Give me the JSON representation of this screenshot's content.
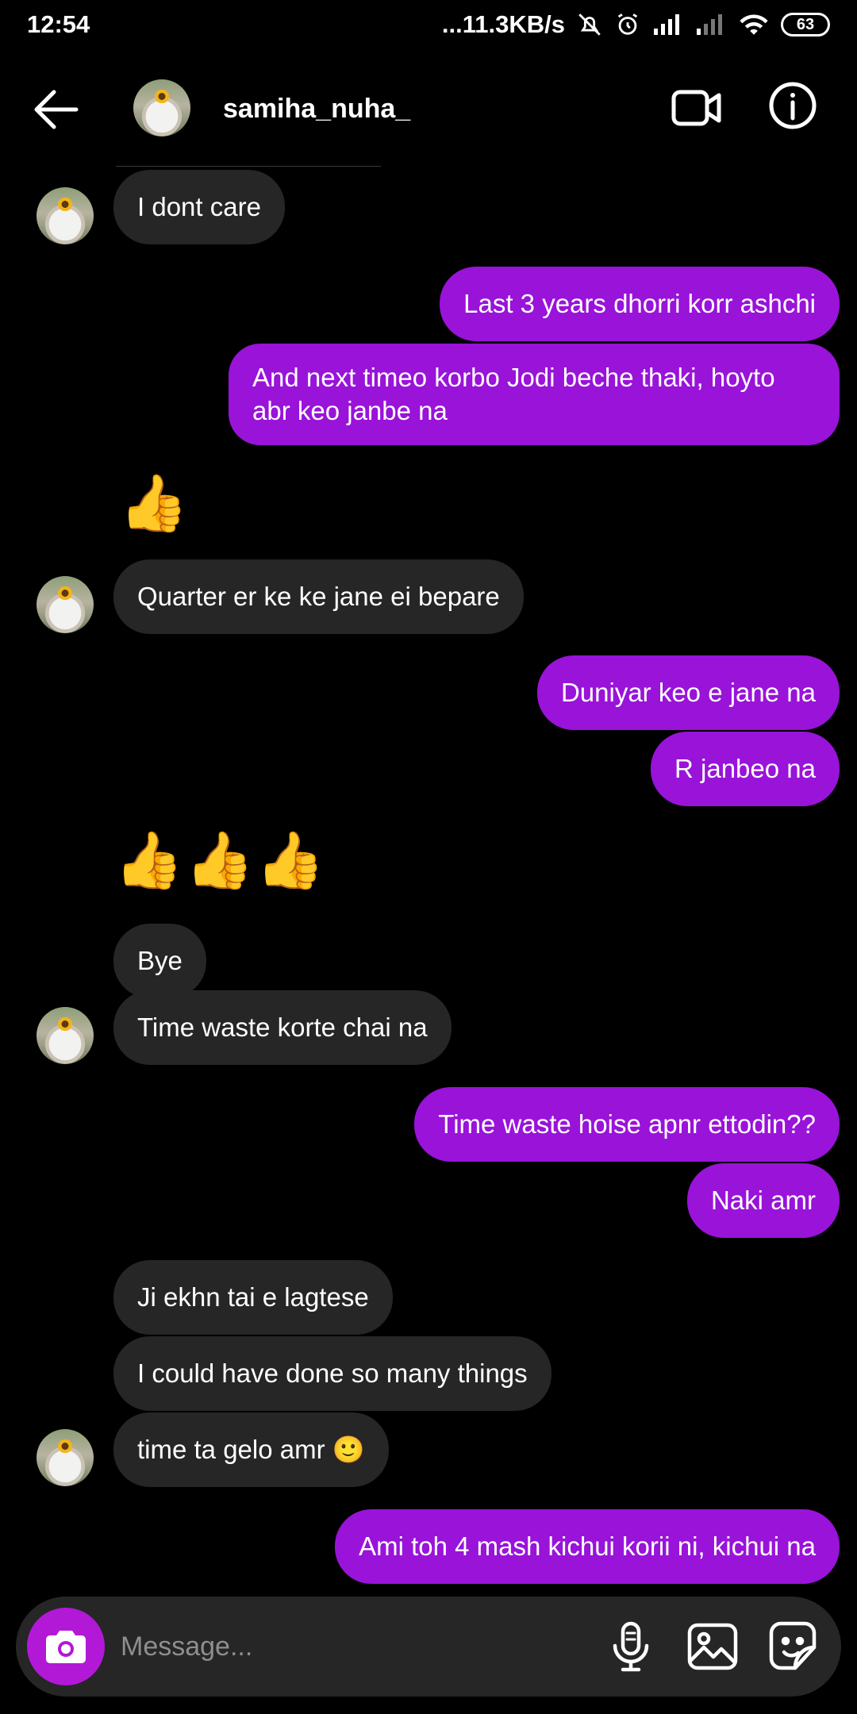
{
  "status_bar": {
    "time": "12:54",
    "network_speed": "...11.3KB/s",
    "battery": "63"
  },
  "header": {
    "username": "samiha_nuha_"
  },
  "messages": [
    {
      "side": "in",
      "text": "I dont care"
    },
    {
      "side": "out",
      "text": "Last 3 years dhorri korr ashchi"
    },
    {
      "side": "out",
      "text": "And next timeo korbo Jodi beche thaki, hoyto abr keo janbe na"
    },
    {
      "side": "in",
      "emoji": "👍"
    },
    {
      "side": "in",
      "text": "Quarter er ke ke jane ei bepare"
    },
    {
      "side": "out",
      "text": "Duniyar keo e jane na"
    },
    {
      "side": "out",
      "text": "R janbeo na"
    },
    {
      "side": "in",
      "emoji": "👍👍👍"
    },
    {
      "side": "in",
      "text": "Bye"
    },
    {
      "side": "in",
      "text": "Time waste korte chai na"
    },
    {
      "side": "out",
      "text": "Time waste hoise apnr ettodin??"
    },
    {
      "side": "out",
      "text": "Naki amr"
    },
    {
      "side": "in",
      "text": "Ji ekhn tai e lagtese"
    },
    {
      "side": "in",
      "text": "I could have done so many things"
    },
    {
      "side": "in",
      "text": "time ta gelo amr 🙂"
    },
    {
      "side": "out",
      "text": "Ami toh 4 mash kichui korii ni, kichui na"
    }
  ],
  "composer": {
    "placeholder": "Message..."
  },
  "icons": {
    "back": "back-arrow-icon",
    "video": "video-call-icon",
    "info": "info-icon",
    "camera": "camera-icon",
    "mic": "microphone-icon",
    "gallery": "gallery-icon",
    "sticker": "sticker-icon"
  },
  "colors": {
    "background": "#000000",
    "incoming_bubble": "#262626",
    "outgoing_bubble": "#9913d9",
    "camera_button": "#b119d6",
    "placeholder": "#8e8e8e"
  }
}
